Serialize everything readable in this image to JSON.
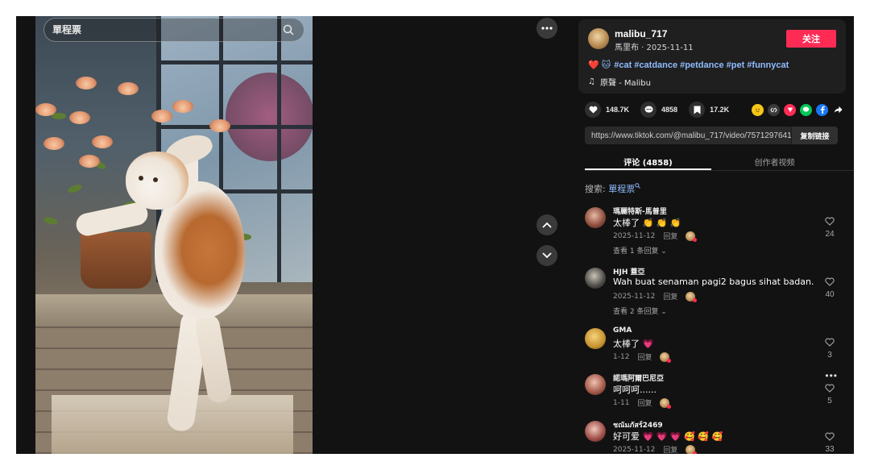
{
  "search": {
    "placeholder": "單程票"
  },
  "author": {
    "name": "malibu_717",
    "meta": "馬里布 · 2025-11-11",
    "follow_label": "关注",
    "caption_emoji": "❤️ 🐱",
    "caption": "#cat #catdance #petdance #pet #funnycat",
    "music_icon": "♫",
    "music": "原聲 - Malibu"
  },
  "stats": {
    "likes": "148.7K",
    "comments": "4858",
    "saves": "17.2K"
  },
  "share_icons": [
    "emoji-icon",
    "embed-icon",
    "send-icon",
    "line-icon",
    "facebook-icon",
    "share-arrow-icon"
  ],
  "link": {
    "url": "https://www.tiktok.com/@malibu_717/video/7571297641...",
    "copy_label": "复制链接"
  },
  "tabs": [
    {
      "label": "评论 (4858)"
    },
    {
      "label": "创作者视频"
    }
  ],
  "search_hint": {
    "prefix": "搜索:",
    "term": "單程票"
  },
  "comments": [
    {
      "name": "瑪麗特斯-馬普里",
      "text": "太棒了 👏 👏 👏",
      "date": "2025-11-12",
      "reply": "回复",
      "view": "查看 1 条回复 ⌄",
      "likes": "24"
    },
    {
      "name": "HJH 蓋亞",
      "text": "Wah buat senaman pagi2 bagus sihat badan.",
      "date": "2025-11-12",
      "reply": "回复",
      "view": "查看 2 条回复 ⌄",
      "likes": "40"
    },
    {
      "name": "GMA",
      "text": "太棒了 💗",
      "date": "1-12",
      "reply": "回复",
      "view": "",
      "likes": "3"
    },
    {
      "name": "諾瑪阿爾巴尼亞",
      "text": "呵呵呵......",
      "date": "1-11",
      "reply": "回复",
      "view": "",
      "likes": "5"
    },
    {
      "name": "ชณัมภัสร์2469",
      "text": "好可爱 💗 💗 💗 🥰 🥰 🥰",
      "date": "2025-11-12",
      "reply": "回复",
      "view": "",
      "likes": "33"
    }
  ],
  "colors": {
    "accent": "#fe2c55",
    "hashtag": "#8fbcff",
    "panel": "#121212"
  }
}
